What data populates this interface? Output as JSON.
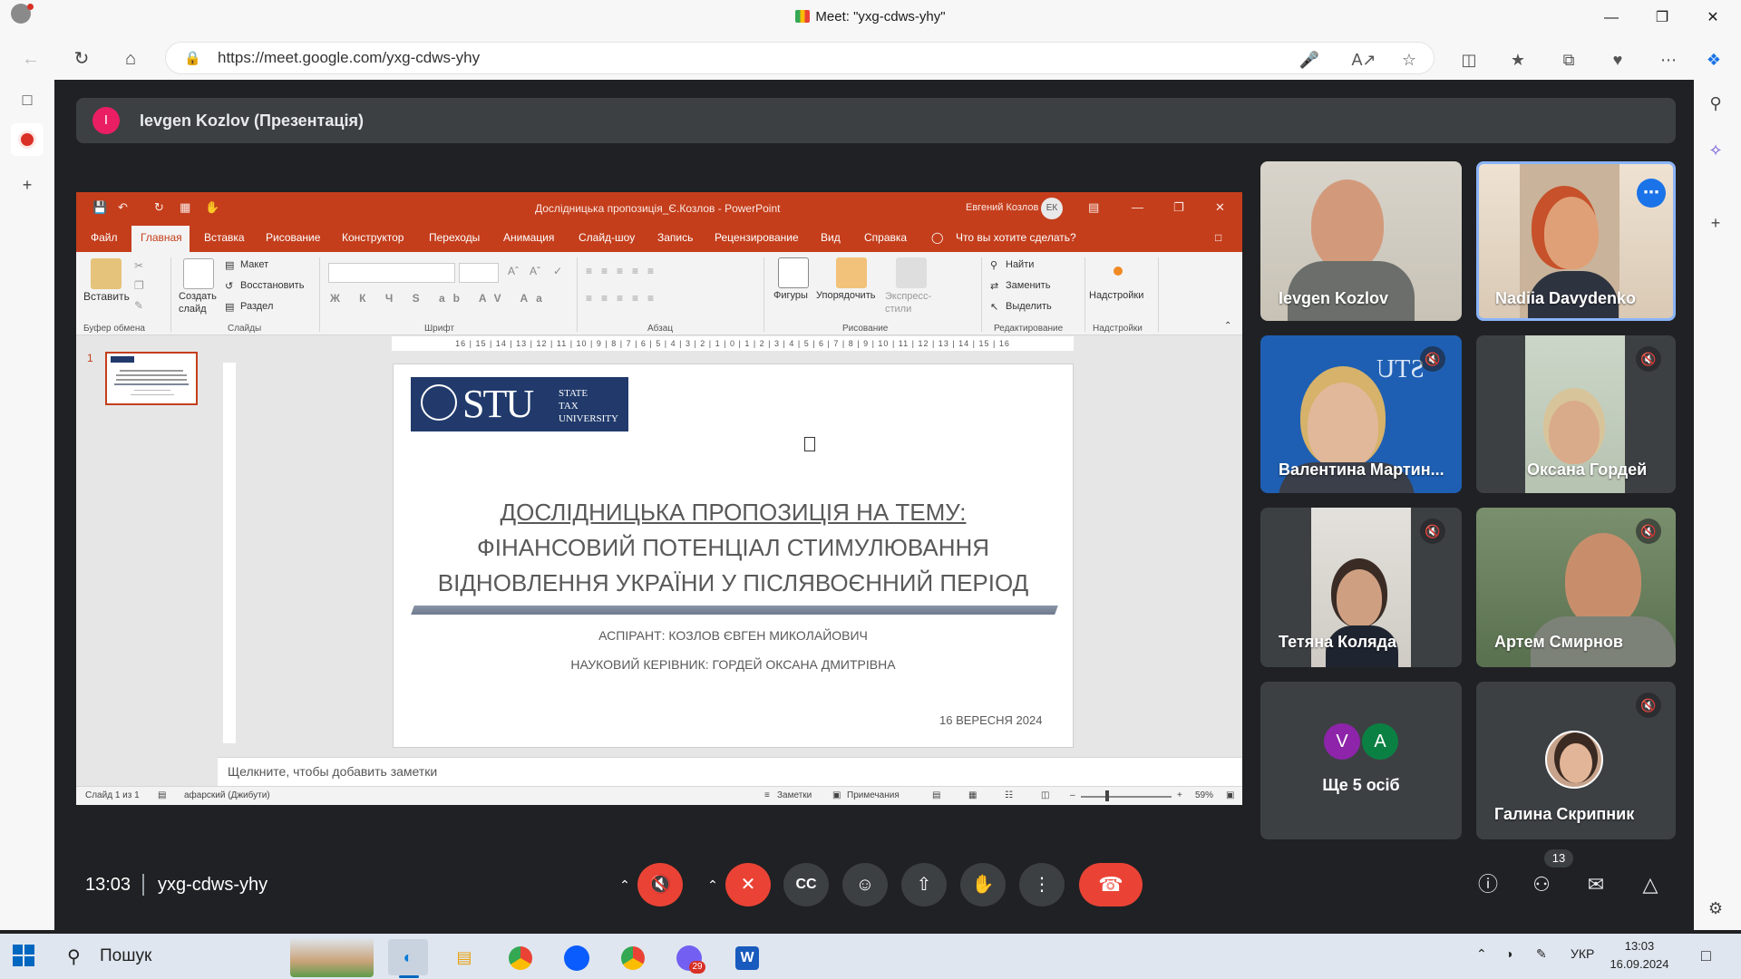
{
  "browser": {
    "window_title": "Meet: \"yxg-cdws-yhy\"",
    "url": "https://meet.google.com/yxg-cdws-yhy"
  },
  "meet": {
    "presenter_initial": "I",
    "presenter_label": "Ievgen Kozlov (Презентація)",
    "time": "13:03",
    "meeting_code": "yxg-cdws-yhy",
    "participant_count": "13",
    "participants": [
      {
        "name": "Ievgen Kozlov",
        "muted": false
      },
      {
        "name": "Nadiia Davydenko",
        "muted": false,
        "active": true
      },
      {
        "name": "Валентина Мартин...",
        "muted": true
      },
      {
        "name": "Оксана Гордей",
        "muted": true
      },
      {
        "name": "Тетяна Коляда",
        "muted": true
      },
      {
        "name": "Артем Смирнов",
        "muted": true
      },
      {
        "name": "Галина Скрипник",
        "muted": true
      }
    ],
    "others": {
      "label": "Ще 5 осіб",
      "avatars": [
        "V",
        "A"
      ]
    },
    "colors": {
      "bg": "#202124",
      "tile": "#3c4043",
      "danger": "#ea4335",
      "presenter_avatar": "#e91e63"
    }
  },
  "powerpoint": {
    "title": "Дослідницька пропозиція_Є.Козлов  -  PowerPoint",
    "user_name": "Евгений Козлов",
    "user_initials": "ЕК",
    "tabs": [
      "Файл",
      "Главная",
      "Вставка",
      "Рисование",
      "Конструктор",
      "Переходы",
      "Анимация",
      "Слайд-шоу",
      "Запись",
      "Рецензирование",
      "Вид",
      "Справка"
    ],
    "tell_me": "Что вы хотите сделать?",
    "ribbon": {
      "paste": "Вставить",
      "new_slide": "Создать слайд",
      "layout": "Макет",
      "reset": "Восстановить",
      "section": "Раздел",
      "shapes": "Фигуры",
      "arrange": "Упорядочить",
      "quick_styles": "Экспресс-стили",
      "find": "Найти",
      "replace": "Заменить",
      "select": "Выделить",
      "addins": "Надстройки",
      "groups": [
        "Буфер обмена",
        "Слайды",
        "Шрифт",
        "Абзац",
        "Рисование",
        "Редактирование",
        "Надстройки"
      ],
      "font_buttons": "Ж К Ч S ab AV Aa"
    },
    "ruler": "16 | 15 | 14 | 13 | 12 | 11 | 10 | 9 | 8 | 7 | 6 | 5 | 4 | 3 | 2 | 1 | 0 | 1 | 2 | 3 | 4 | 5 | 6 | 7 | 8 | 9 | 10 | 11 | 12 | 13 | 14 | 15 | 16",
    "thumb_number": "1",
    "slide": {
      "logo_big": "STU",
      "logo_small": [
        "STATE",
        "TAX",
        "UNIVERSITY"
      ],
      "title_line1": "ДОСЛІДНИЦЬКА ПРОПОЗИЦІЯ НА ТЕМУ:",
      "title_line2": "ФІНАНСОВИЙ ПОТЕНЦІАЛ СТИМУЛЮВАННЯ",
      "title_line3": "ВІДНОВЛЕННЯ УКРАЇНИ У ПІСЛЯВОЄННИЙ ПЕРІОД",
      "author": "АСПІРАНТ: КОЗЛОВ ЄВГЕН МИКОЛАЙОВИЧ",
      "supervisor": "НАУКОВИЙ КЕРІВНИК: ГОРДЕЙ ОКСАНА ДМИТРІВНА",
      "date": "16 ВЕРЕСНЯ 2024"
    },
    "notes_placeholder": "Щелкните, чтобы добавить заметки",
    "status": {
      "slide_of": "Слайд 1 из 1",
      "language": "афарский (Джибути)",
      "notes": "Заметки",
      "comments": "Примечания",
      "zoom": "59%"
    },
    "colors": {
      "accent": "#c43e1c",
      "logo_bg": "#213a6b"
    }
  },
  "taskbar": {
    "search_placeholder": "Пошук",
    "language": "УКР",
    "time": "13:03",
    "date": "16.09.2024",
    "viber_badge": "29"
  }
}
